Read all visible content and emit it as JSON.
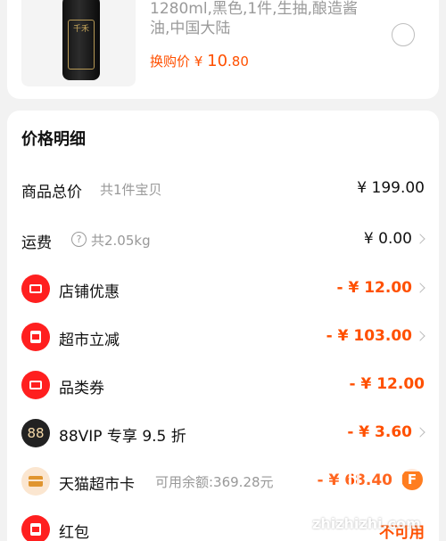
{
  "product": {
    "description": "1280ml,黑色,1件,生抽,酿造酱油,中国大陆",
    "swap_label": "换购价",
    "currency": "¥",
    "price_int": "10",
    "price_dec": ".80",
    "bottle_mark": "千禾"
  },
  "detail": {
    "title": "价格明细",
    "rows": [
      {
        "label": "商品总价",
        "sub": "共1件宝贝",
        "amount": "¥ 199.00"
      },
      {
        "label": "运费",
        "help_icon": "?",
        "sub": "共2.05kg",
        "amount": "¥ 0.00"
      },
      {
        "label": "店铺优惠",
        "amount": "- ¥ 12.00"
      },
      {
        "label": "超市立减",
        "amount": "- ¥ 103.00"
      },
      {
        "label": "品类券",
        "amount": "- ¥ 12.00"
      },
      {
        "label": "88VIP 专享 9.5 折",
        "icon_text": "88",
        "amount": "- ¥ 3.60"
      },
      {
        "label": "天猫超市卡",
        "sub": "可用余额:369.28元",
        "amount": "- ¥ 68.40",
        "badge": "F"
      },
      {
        "label": "红包",
        "amount": "不可用"
      }
    ]
  },
  "colors": {
    "accent": "#ff5000",
    "icon_red": "#ff1f1f",
    "icon_dark": "#222222",
    "icon_tan": "#fbe6d0"
  },
  "icons": [
    "radio-unchecked-icon",
    "help-circle-icon",
    "shop-coupon-icon",
    "supermarket-discount-icon",
    "category-coupon-icon",
    "vip-88-icon",
    "tmall-card-icon",
    "red-packet-icon",
    "chevron-right-icon"
  ],
  "watermark": "zhizhizhi.com"
}
